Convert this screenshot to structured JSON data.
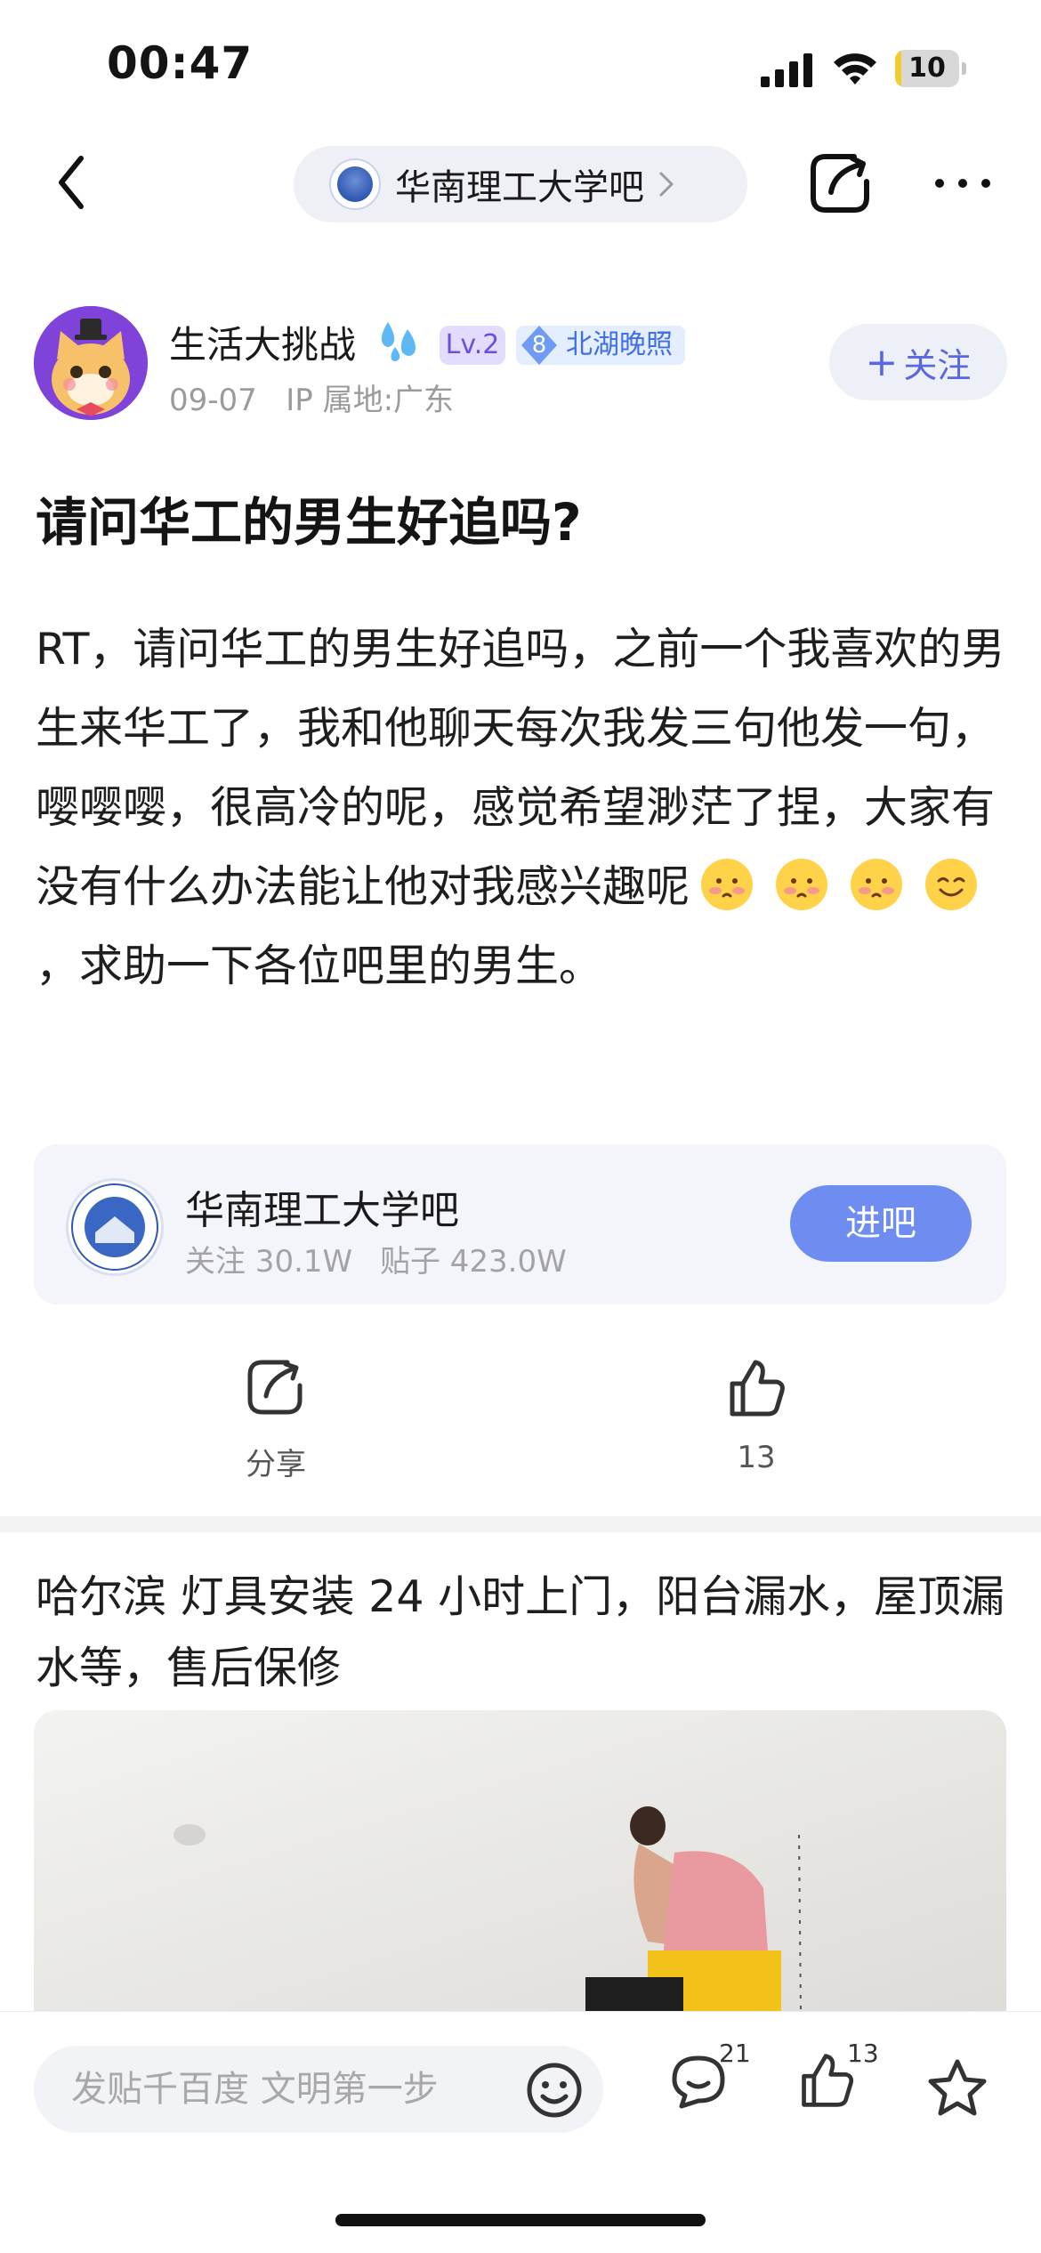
{
  "status_bar": {
    "time": "00:47",
    "battery_level": "10",
    "battery_fraction": 0.1
  },
  "nav": {
    "forum_name": "华南理工大学吧"
  },
  "post": {
    "author_name": "生活大挑战",
    "level": "Lv.2",
    "rank_number": "8",
    "rank_title": "北湖晚照",
    "date": "09-07",
    "ip_location": "IP 属地:广东",
    "follow_label": "关注",
    "title": "请问华工的男生好追吗?",
    "body_part1": "RT，请问华工的男生好追吗，之前一个我喜欢的男生来华工了，我和他聊天每次我发三句他发一句，嘤嘤嘤，很高冷的呢，感觉希望渺茫了捏，大家有没有什么办法能让他对我感兴趣呢",
    "body_part2": "，求助一下各位吧里的男生。",
    "emojis": [
      "blushing-face-icon",
      "blushing-face-icon",
      "blushing-face-icon",
      "smiling-face-icon"
    ]
  },
  "forum_card": {
    "name": "华南理工大学吧",
    "followers": "关注 30.1W",
    "posts": "贴子 423.0W",
    "enter_label": "进吧"
  },
  "actions": {
    "share_label": "分享",
    "like_count": "13"
  },
  "ad": {
    "title": "哈尔滨 灯具安装 24 小时上门，阳台漏水，屋顶漏水等，售后保修"
  },
  "bottom_bar": {
    "input_placeholder": "发贴千百度 文明第一步",
    "comment_count": "21",
    "like_count": "13"
  },
  "colors": {
    "accent": "#6f8cf0",
    "follow_text": "#5a67e0",
    "level_badge_bg": "#e3dcff",
    "rank_badge_text": "#3f6fe6",
    "avatar_bg": "#7f43d9"
  }
}
